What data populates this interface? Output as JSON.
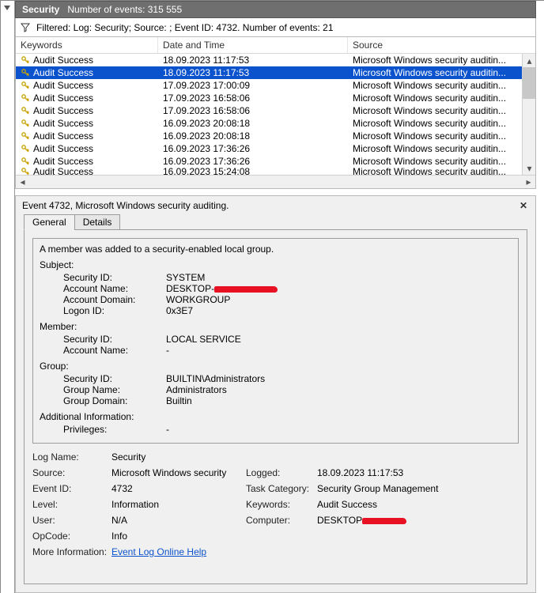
{
  "titlebar": {
    "app": "Security",
    "count_label": "Number of events:",
    "count": "315 555"
  },
  "filter_text": "Filtered: Log: Security; Source: ; Event ID: 4732. Number of events: 21",
  "columns": {
    "keywords": "Keywords",
    "datetime": "Date and Time",
    "source": "Source"
  },
  "source_text": "Microsoft Windows security auditin...",
  "rows": [
    {
      "k": "Audit Success",
      "dt": "18.09.2023 11:17:53",
      "sel": false
    },
    {
      "k": "Audit Success",
      "dt": "18.09.2023 11:17:53",
      "sel": true
    },
    {
      "k": "Audit Success",
      "dt": "17.09.2023 17:00:09",
      "sel": false
    },
    {
      "k": "Audit Success",
      "dt": "17.09.2023 16:58:06",
      "sel": false
    },
    {
      "k": "Audit Success",
      "dt": "17.09.2023 16:58:06",
      "sel": false
    },
    {
      "k": "Audit Success",
      "dt": "16.09.2023 20:08:18",
      "sel": false
    },
    {
      "k": "Audit Success",
      "dt": "16.09.2023 20:08:18",
      "sel": false
    },
    {
      "k": "Audit Success",
      "dt": "16.09.2023 17:36:26",
      "sel": false
    },
    {
      "k": "Audit Success",
      "dt": "16.09.2023 17:36:26",
      "sel": false
    },
    {
      "k": "Audit Success",
      "dt": "16.09.2023 15:24:08",
      "sel": false,
      "half": true
    }
  ],
  "detail_title": "Event 4732, Microsoft Windows security auditing.",
  "tabs": {
    "general": "General",
    "details": "Details"
  },
  "message": {
    "summary_line": "A member was added to a security-enabled local group.",
    "subject_label": "Subject:",
    "subject": {
      "security_id_k": "Security ID:",
      "security_id_v": "SYSTEM",
      "account_name_k": "Account Name:",
      "account_name_v": "DESKTOP-",
      "account_domain_k": "Account Domain:",
      "account_domain_v": "WORKGROUP",
      "logon_id_k": "Logon ID:",
      "logon_id_v": "0x3E7"
    },
    "member_label": "Member:",
    "member": {
      "security_id_k": "Security ID:",
      "security_id_v": "LOCAL SERVICE",
      "account_name_k": "Account Name:",
      "account_name_v": "-"
    },
    "group_label": "Group:",
    "group": {
      "security_id_k": "Security ID:",
      "security_id_v": "BUILTIN\\Administrators",
      "group_name_k": "Group Name:",
      "group_name_v": "Administrators",
      "group_domain_k": "Group Domain:",
      "group_domain_v": "Builtin"
    },
    "addl_label": "Additional Information:",
    "addl": {
      "privileges_k": "Privileges:",
      "privileges_v": "-"
    }
  },
  "summary": {
    "log_name_k": "Log Name:",
    "log_name_v": "Security",
    "source_k": "Source:",
    "source_v": "Microsoft Windows security",
    "logged_k": "Logged:",
    "logged_v": "18.09.2023 11:17:53",
    "event_id_k": "Event ID:",
    "event_id_v": "4732",
    "task_cat_k": "Task Category:",
    "task_cat_v": "Security Group Management",
    "level_k": "Level:",
    "level_v": "Information",
    "keywords_k": "Keywords:",
    "keywords_v": "Audit Success",
    "user_k": "User:",
    "user_v": "N/A",
    "computer_k": "Computer:",
    "computer_v": "DESKTOP",
    "opcode_k": "OpCode:",
    "opcode_v": "Info",
    "more_info_k": "More Information:",
    "more_info_link": "Event Log Online Help"
  }
}
